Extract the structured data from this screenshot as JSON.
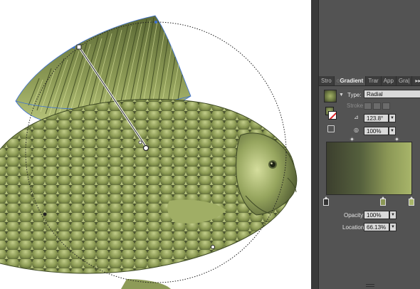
{
  "panel": {
    "tabs": [
      {
        "label": "Stro"
      },
      {
        "label": "Gradient"
      },
      {
        "label": "Trar"
      },
      {
        "label": "App"
      },
      {
        "label": "Gra|"
      }
    ],
    "more_glyph": "▸▸",
    "type_label": "Type:",
    "type_value": "Radial",
    "stroke_label": "Stroke:",
    "angle_value": "123.8°",
    "aspect_value": "100%",
    "opacity_label": "Opacity:",
    "opacity_value": "100%",
    "location_label": "Location:",
    "location_value": "66.13%",
    "gradient_stops": [
      {
        "position": 0.0,
        "color": "#3c3f2e"
      },
      {
        "position": 0.66,
        "color": "#8b9756"
      },
      {
        "position": 1.0,
        "color": "#a8b56a"
      }
    ]
  },
  "colors": {
    "panel_bg": "#535353",
    "fish_body": "#7b8a4c",
    "fish_dark": "#4b5530",
    "fish_light": "#c4d08a",
    "selection": "#3b6fd4"
  }
}
